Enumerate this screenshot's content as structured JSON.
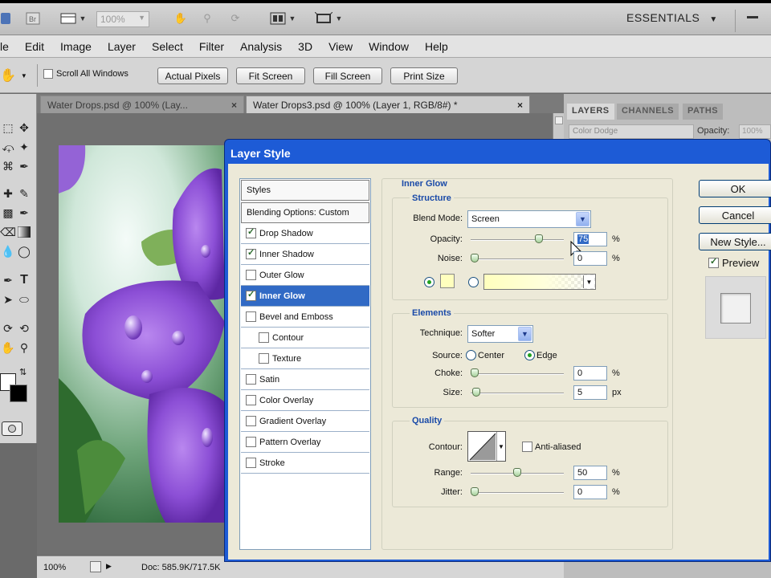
{
  "appbar": {
    "zoom_value": "100%",
    "workspace": "ESSENTIALS",
    "icons": [
      "bridge-icon",
      "minibridge-icon",
      "view-extras-icon",
      "zoom-level-dropdown",
      "hand-icon",
      "zoom-icon",
      "rotate-view-icon",
      "arrange-documents-icon",
      "screen-mode-icon"
    ]
  },
  "menu": [
    "le",
    "Edit",
    "Image",
    "Layer",
    "Select",
    "Filter",
    "Analysis",
    "3D",
    "View",
    "Window",
    "Help"
  ],
  "options": {
    "scroll_all": "Scroll All Windows",
    "buttons": [
      "Actual Pixels",
      "Fit Screen",
      "Fill Screen",
      "Print Size"
    ]
  },
  "tabs": [
    {
      "label": "Water Drops.psd @ 100% (Lay...",
      "active": false
    },
    {
      "label": "Water Drops3.psd @ 100% (Layer 1, RGB/8#) *",
      "active": true
    }
  ],
  "status": {
    "zoom": "100%",
    "doc": "Doc: 585.9K/717.5K"
  },
  "layers_panel": {
    "tabs": [
      "LAYERS",
      "CHANNELS",
      "PATHS"
    ],
    "blend_mode": "Color Dodge",
    "opacity_label": "Opacity:",
    "opacity_value": "100%"
  },
  "dialog": {
    "title": "Layer Style",
    "styles_header": "Styles",
    "blending_options": "Blending Options: Custom",
    "style_items": [
      {
        "label": "Drop Shadow",
        "checked": true,
        "selected": false,
        "sub": false
      },
      {
        "label": "Inner Shadow",
        "checked": true,
        "selected": false,
        "sub": false
      },
      {
        "label": "Outer Glow",
        "checked": false,
        "selected": false,
        "sub": false
      },
      {
        "label": "Inner Glow",
        "checked": true,
        "selected": true,
        "sub": false
      },
      {
        "label": "Bevel and Emboss",
        "checked": false,
        "selected": false,
        "sub": false
      },
      {
        "label": "Contour",
        "checked": false,
        "selected": false,
        "sub": true
      },
      {
        "label": "Texture",
        "checked": false,
        "selected": false,
        "sub": true
      },
      {
        "label": "Satin",
        "checked": false,
        "selected": false,
        "sub": false
      },
      {
        "label": "Color Overlay",
        "checked": false,
        "selected": false,
        "sub": false
      },
      {
        "label": "Gradient Overlay",
        "checked": false,
        "selected": false,
        "sub": false
      },
      {
        "label": "Pattern Overlay",
        "checked": false,
        "selected": false,
        "sub": false
      },
      {
        "label": "Stroke",
        "checked": false,
        "selected": false,
        "sub": false
      }
    ],
    "inner_glow": {
      "title": "Inner Glow",
      "structure": {
        "title": "Structure",
        "blend_mode_label": "Blend Mode:",
        "blend_mode": "Screen",
        "opacity_label": "Opacity:",
        "opacity": "75",
        "opacity_level": 0.75,
        "noise_label": "Noise:",
        "noise": "0",
        "noise_level": 0.0,
        "pct": "%",
        "glow_color": "#ffffbe"
      },
      "elements": {
        "title": "Elements",
        "technique_label": "Technique:",
        "technique": "Softer",
        "source_label": "Source:",
        "center": "Center",
        "edge": "Edge",
        "choke_label": "Choke:",
        "choke": "0",
        "choke_level": 0.0,
        "size_label": "Size:",
        "size": "5",
        "size_level": 0.02,
        "pct": "%",
        "px": "px"
      },
      "quality": {
        "title": "Quality",
        "contour_label": "Contour:",
        "anti_aliased": "Anti-aliased",
        "range_label": "Range:",
        "range": "50",
        "range_level": 0.5,
        "jitter_label": "Jitter:",
        "jitter": "0",
        "jitter_level": 0.0,
        "pct": "%"
      }
    },
    "buttons": {
      "ok": "OK",
      "cancel": "Cancel",
      "new_style": "New Style...",
      "preview": "Preview"
    }
  }
}
